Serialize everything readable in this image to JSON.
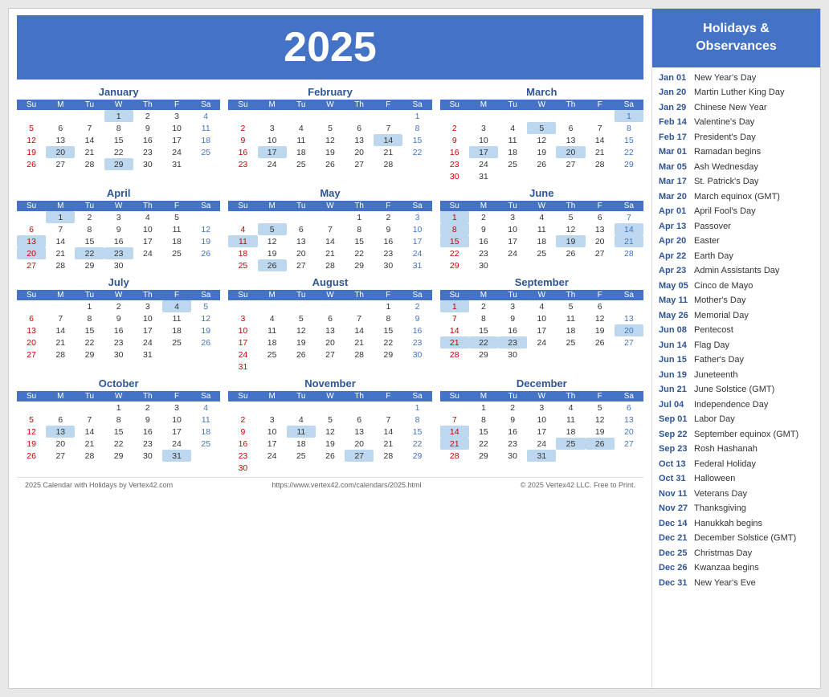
{
  "header": {
    "year": "2025"
  },
  "sidebar": {
    "title": "Holidays &\nObservances",
    "items": [
      {
        "date": "Jan 01",
        "name": "New Year's Day"
      },
      {
        "date": "Jan 20",
        "name": "Martin Luther King Day"
      },
      {
        "date": "Jan 29",
        "name": "Chinese New Year"
      },
      {
        "date": "Feb 14",
        "name": "Valentine's Day"
      },
      {
        "date": "Feb 17",
        "name": "President's Day"
      },
      {
        "date": "Mar 01",
        "name": "Ramadan begins"
      },
      {
        "date": "Mar 05",
        "name": "Ash Wednesday"
      },
      {
        "date": "Mar 17",
        "name": "St. Patrick's Day"
      },
      {
        "date": "Mar 20",
        "name": "March equinox (GMT)"
      },
      {
        "date": "Apr 01",
        "name": "April Fool's Day"
      },
      {
        "date": "Apr 13",
        "name": "Passover"
      },
      {
        "date": "Apr 20",
        "name": "Easter"
      },
      {
        "date": "Apr 22",
        "name": "Earth Day"
      },
      {
        "date": "Apr 23",
        "name": "Admin Assistants Day"
      },
      {
        "date": "May 05",
        "name": "Cinco de Mayo"
      },
      {
        "date": "May 11",
        "name": "Mother's Day"
      },
      {
        "date": "May 26",
        "name": "Memorial Day"
      },
      {
        "date": "Jun 08",
        "name": "Pentecost"
      },
      {
        "date": "Jun 14",
        "name": "Flag Day"
      },
      {
        "date": "Jun 15",
        "name": "Father's Day"
      },
      {
        "date": "Jun 19",
        "name": "Juneteenth"
      },
      {
        "date": "Jun 21",
        "name": "June Solstice (GMT)"
      },
      {
        "date": "Jul 04",
        "name": "Independence Day"
      },
      {
        "date": "Sep 01",
        "name": "Labor Day"
      },
      {
        "date": "Sep 22",
        "name": "September equinox (GMT)"
      },
      {
        "date": "Sep 23",
        "name": "Rosh Hashanah"
      },
      {
        "date": "Oct 13",
        "name": "Federal Holiday"
      },
      {
        "date": "Oct 31",
        "name": "Halloween"
      },
      {
        "date": "Nov 11",
        "name": "Veterans Day"
      },
      {
        "date": "Nov 27",
        "name": "Thanksgiving"
      },
      {
        "date": "Dec 14",
        "name": "Hanukkah begins"
      },
      {
        "date": "Dec 21",
        "name": "December Solstice (GMT)"
      },
      {
        "date": "Dec 25",
        "name": "Christmas Day"
      },
      {
        "date": "Dec 26",
        "name": "Kwanzaa begins"
      },
      {
        "date": "Dec 31",
        "name": "New Year's Eve"
      }
    ]
  },
  "footer": {
    "left": "2025 Calendar with Holidays by Vertex42.com",
    "center": "https://www.vertex42.com/calendars/2025.html",
    "right": "© 2025 Vertex42 LLC. Free to Print."
  }
}
